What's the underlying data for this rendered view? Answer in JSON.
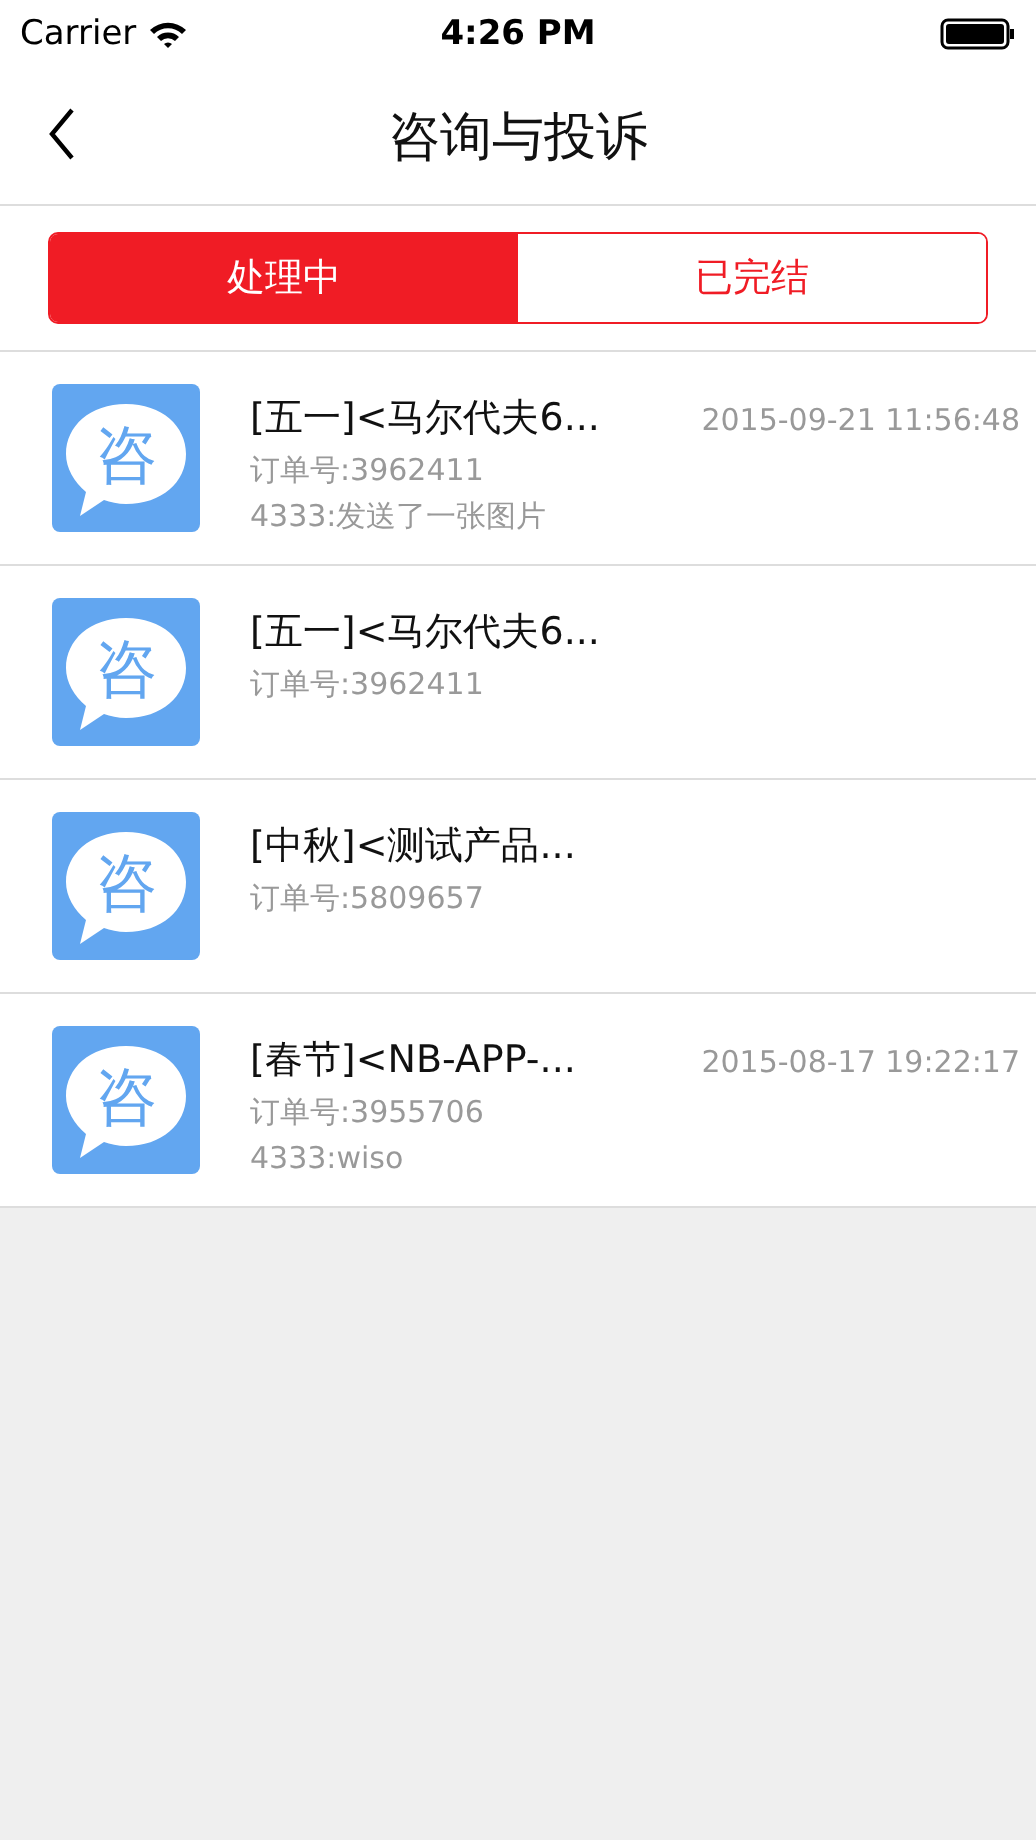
{
  "status_bar": {
    "carrier": "Carrier",
    "time": "4:26 PM"
  },
  "nav": {
    "title": "咨询与投诉"
  },
  "tabs": [
    {
      "label": "处理中",
      "selected": true
    },
    {
      "label": "已完结",
      "selected": false
    }
  ],
  "items": [
    {
      "icon_char": "咨",
      "title": "[五一]<马尔代夫6...",
      "time": "2015-09-21 11:56:48",
      "order": "订单号:3962411",
      "message": "4333:发送了一张图片"
    },
    {
      "icon_char": "咨",
      "title": "[五一]<马尔代夫6...",
      "order": "订单号:3962411"
    },
    {
      "icon_char": "咨",
      "title": "[中秋]<测试产品...",
      "order": "订单号:5809657"
    },
    {
      "icon_char": "咨",
      "title": "[春节]<NB-APP-...",
      "time": "2015-08-17 19:22:17",
      "order": "订单号:3955706",
      "message": "4333:wiso"
    }
  ]
}
